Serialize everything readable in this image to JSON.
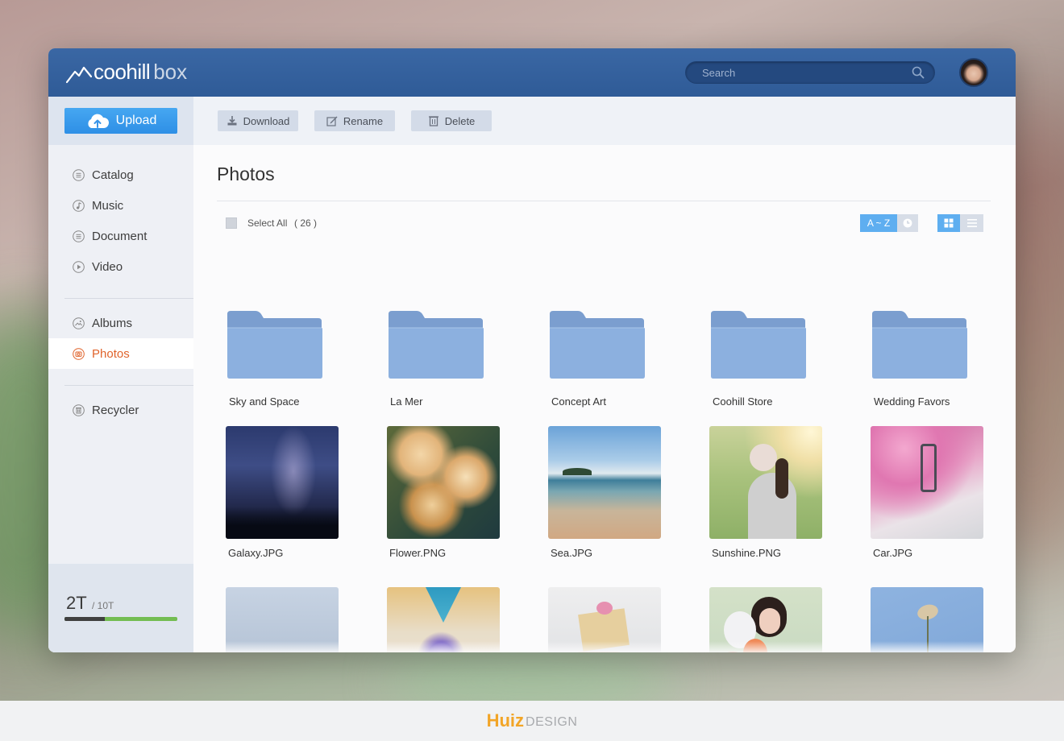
{
  "app": {
    "logo_main": "coohill",
    "logo_sub": "box"
  },
  "search": {
    "placeholder": "Search"
  },
  "sidebar": {
    "upload_label": "Upload",
    "items": [
      {
        "label": "Catalog"
      },
      {
        "label": "Music"
      },
      {
        "label": "Document"
      },
      {
        "label": "Video"
      },
      {
        "label": "Albums"
      },
      {
        "label": "Photos",
        "active": true
      },
      {
        "label": "Recycler"
      }
    ],
    "storage": {
      "used": "2T",
      "total": "/ 10T",
      "used_fraction": 0.36
    }
  },
  "toolbar": {
    "download_label": "Download",
    "rename_label": "Rename",
    "delete_label": "Delete"
  },
  "main": {
    "title": "Photos",
    "select_all_label": "Select All",
    "count": "( 26 )",
    "sort_az_label": "A ~ Z",
    "folders": [
      "Sky and Space",
      "La Mer",
      "Concept Art",
      "Coohill Store",
      "Wedding Favors"
    ],
    "photos": [
      {
        "name": "Galaxy.JPG",
        "thumb": "galaxy"
      },
      {
        "name": "Flower.PNG",
        "thumb": "flower"
      },
      {
        "name": "Sea.JPG",
        "thumb": "sea"
      },
      {
        "name": "Sunshine.PNG",
        "thumb": "sunshine"
      },
      {
        "name": "Car.JPG",
        "thumb": "car"
      }
    ],
    "photos_row3": [
      {
        "thumb": "fog"
      },
      {
        "thumb": "hands-flower"
      },
      {
        "thumb": "gift"
      },
      {
        "thumb": "balloons"
      },
      {
        "thumb": "grass"
      }
    ]
  },
  "colors": {
    "accent": "#3a8fe8",
    "active_nav": "#e0632b",
    "topbar": "#345f9c",
    "storage_bar": "#73bd52"
  },
  "footer": {
    "brand_main": "Huiz",
    "brand_sub": "DESIGN"
  }
}
